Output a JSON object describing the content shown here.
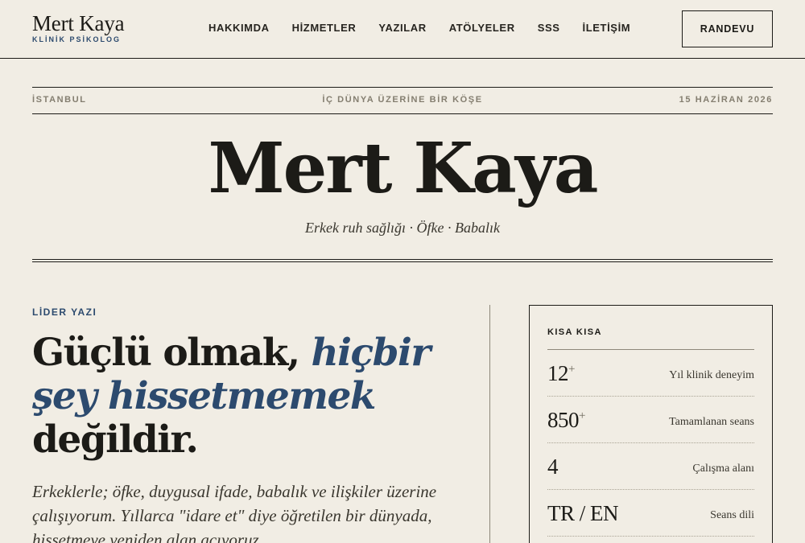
{
  "brand": {
    "name": "Mert Kaya",
    "subtitle": "KLİNİK PSİKOLOG"
  },
  "nav": {
    "items": [
      "HAKKIMDA",
      "HİZMETLER",
      "YAZILAR",
      "ATÖLYELER",
      "SSS",
      "İLETİŞİM"
    ],
    "cta": "RANDEVU"
  },
  "meta": {
    "city": "İSTANBUL",
    "section": "İÇ DÜNYA ÜZERİNE BİR KÖŞE",
    "date": "15 HAZİRAN 2026"
  },
  "masthead": {
    "title": "Mert Kaya",
    "tagline": "Erkek ruh sağlığı · Öfke · Babalık"
  },
  "lead": {
    "kicker": "LİDER YAZI",
    "headline_part1": "Güçlü olmak, ",
    "headline_accent": "hiçbir şey hissetmemek",
    "headline_part2": " değildir.",
    "lede": "Erkeklerle; öfke, duygusal ifade, babalık ve ilişkiler üzerine çalışıyorum. Yıllarca \"idare et\" diye öğretilen bir dünyada, hissetmeye yeniden alan açıyoruz."
  },
  "facts": {
    "title": "KISA KISA",
    "items": [
      {
        "value": "12",
        "suffix": "+",
        "label": "Yıl klinik deneyim"
      },
      {
        "value": "850",
        "suffix": "+",
        "label": "Tamamlanan seans"
      },
      {
        "value": "4",
        "suffix": "",
        "label": "Çalışma alanı"
      },
      {
        "value": "TR / EN",
        "suffix": "",
        "label": "Seans dili"
      }
    ]
  },
  "colors": {
    "background": "#f1ede4",
    "ink": "#1c1b17",
    "accent": "#2c4a6e",
    "muted": "#847e70"
  }
}
